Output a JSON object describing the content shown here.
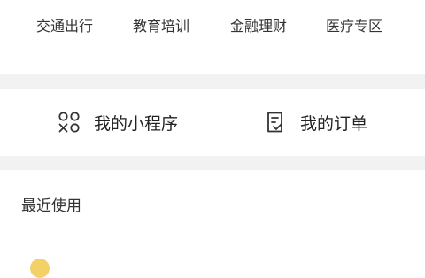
{
  "categories": [
    {
      "label": "交通出行"
    },
    {
      "label": "教育培训"
    },
    {
      "label": "金融理财"
    },
    {
      "label": "医疗专区"
    }
  ],
  "shortcuts": {
    "mini_programs": {
      "label": "我的小程序",
      "icon": "mini-program-icon"
    },
    "orders": {
      "label": "我的订单",
      "icon": "order-list-icon"
    }
  },
  "recent": {
    "title": "最近使用"
  },
  "colors": {
    "separator": "#f2f2f2",
    "text": "#333333",
    "accent_peek": "#f2c94c"
  }
}
